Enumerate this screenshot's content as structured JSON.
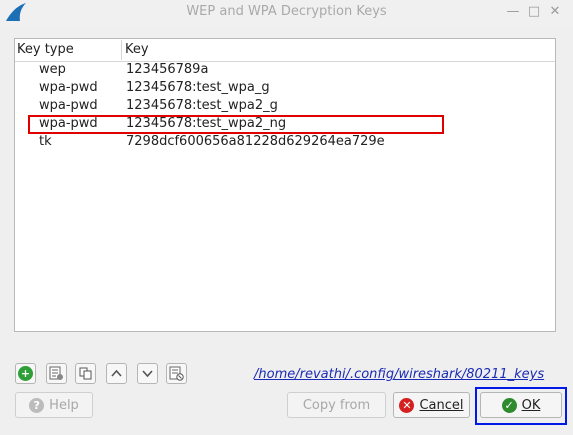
{
  "window": {
    "title": "WEP and WPA Decryption Keys",
    "controls": [
      "minimize",
      "maximize",
      "close"
    ]
  },
  "table": {
    "columns": [
      "Key type",
      "Key"
    ],
    "rows": [
      {
        "type": "wep",
        "key": "123456789a"
      },
      {
        "type": "wpa-pwd",
        "key": "12345678:test_wpa_g"
      },
      {
        "type": "wpa-pwd",
        "key": "12345678:test_wpa2_g"
      },
      {
        "type": "wpa-pwd",
        "key": "12345678:test_wpa2_ng",
        "highlighted": true
      },
      {
        "type": "tk",
        "key": "7298dcf600656a81228d629264ea729e"
      }
    ]
  },
  "toolbar": {
    "icons": [
      "add-icon",
      "copy-entry-icon",
      "copy-icon",
      "move-up-icon",
      "move-down-icon",
      "clear-icon"
    ],
    "file_path": "/home/revathi/.config/wireshark/80211_keys"
  },
  "buttons": {
    "help": "Help",
    "copy_from": "Copy from",
    "cancel": "Cancel",
    "ok": "OK"
  },
  "colors": {
    "highlight_border": "#e00000",
    "ok_focus_border": "#0019e6",
    "add_green": "#2e9e37",
    "cancel_red": "#d42020",
    "ok_green": "#2e8b2e",
    "link_blue": "#1b2bb5"
  }
}
